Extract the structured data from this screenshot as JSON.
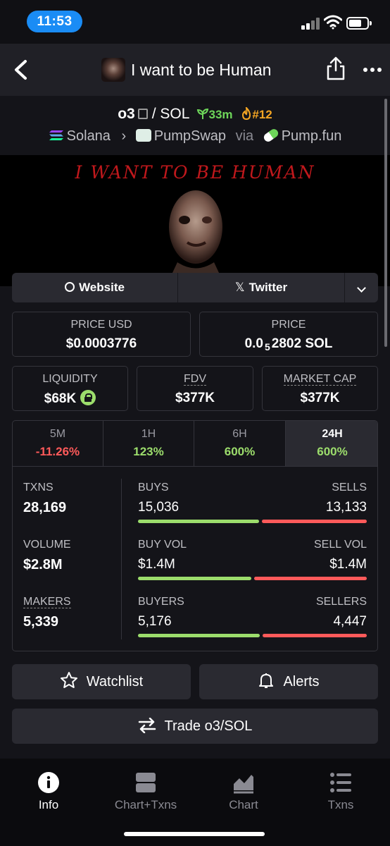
{
  "status_bar": {
    "time": "11:53"
  },
  "header": {
    "title": "I want to be Human"
  },
  "pair": {
    "symbol": "o3",
    "quote": "/ SOL",
    "age": "33m",
    "rank": "#12",
    "chain": "Solana",
    "dex": "PumpSwap",
    "via": "via",
    "launchpad": "Pump.fun"
  },
  "banner": {
    "text": "I WANT TO BE HUMAN"
  },
  "links": {
    "website": "Website",
    "twitter": "Twitter"
  },
  "price_usd": {
    "label": "PRICE USD",
    "value": "$0.0003776"
  },
  "price_native": {
    "label": "PRICE",
    "prefix": "0.0",
    "zeros": "5",
    "digits": "2802",
    "unit": "SOL"
  },
  "liquidity": {
    "label": "LIQUIDITY",
    "value": "$68K"
  },
  "fdv": {
    "label": "FDV",
    "value": "$377K"
  },
  "market_cap": {
    "label": "MARKET CAP",
    "value": "$377K"
  },
  "timeframes": [
    {
      "label": "5M",
      "change": "-11.26%"
    },
    {
      "label": "1H",
      "change": "123%"
    },
    {
      "label": "6H",
      "change": "600%"
    },
    {
      "label": "24H",
      "change": "600%"
    }
  ],
  "metrics": {
    "txns": {
      "label": "TXNS",
      "value": "28,169"
    },
    "volume": {
      "label": "VOLUME",
      "value": "$2.8M"
    },
    "makers": {
      "label": "MAKERS",
      "value": "5,339"
    }
  },
  "splits": {
    "buys": {
      "left_label": "BUYS",
      "right_label": "SELLS",
      "left_value": "15,036",
      "right_value": "13,133",
      "left_ratio": 0.534
    },
    "vol": {
      "left_label": "BUY VOL",
      "right_label": "SELL VOL",
      "left_value": "$1.4M",
      "right_value": "$1.4M",
      "left_ratio": 0.5
    },
    "buyers": {
      "left_label": "BUYERS",
      "right_label": "SELLERS",
      "left_value": "5,176",
      "right_value": "4,447",
      "left_ratio": 0.538
    }
  },
  "actions": {
    "watchlist": "Watchlist",
    "alerts": "Alerts",
    "trade": "Trade o3/SOL"
  },
  "tabs": [
    {
      "label": "Info",
      "icon": "info-icon"
    },
    {
      "label": "Chart+Txns",
      "icon": "split-icon"
    },
    {
      "label": "Chart",
      "icon": "chart-icon"
    },
    {
      "label": "Txns",
      "icon": "list-icon"
    }
  ],
  "colors": {
    "positive": "#9cdd6c",
    "negative": "#ff5a5a",
    "accent": "#1a8cf5",
    "background": "#141419"
  }
}
